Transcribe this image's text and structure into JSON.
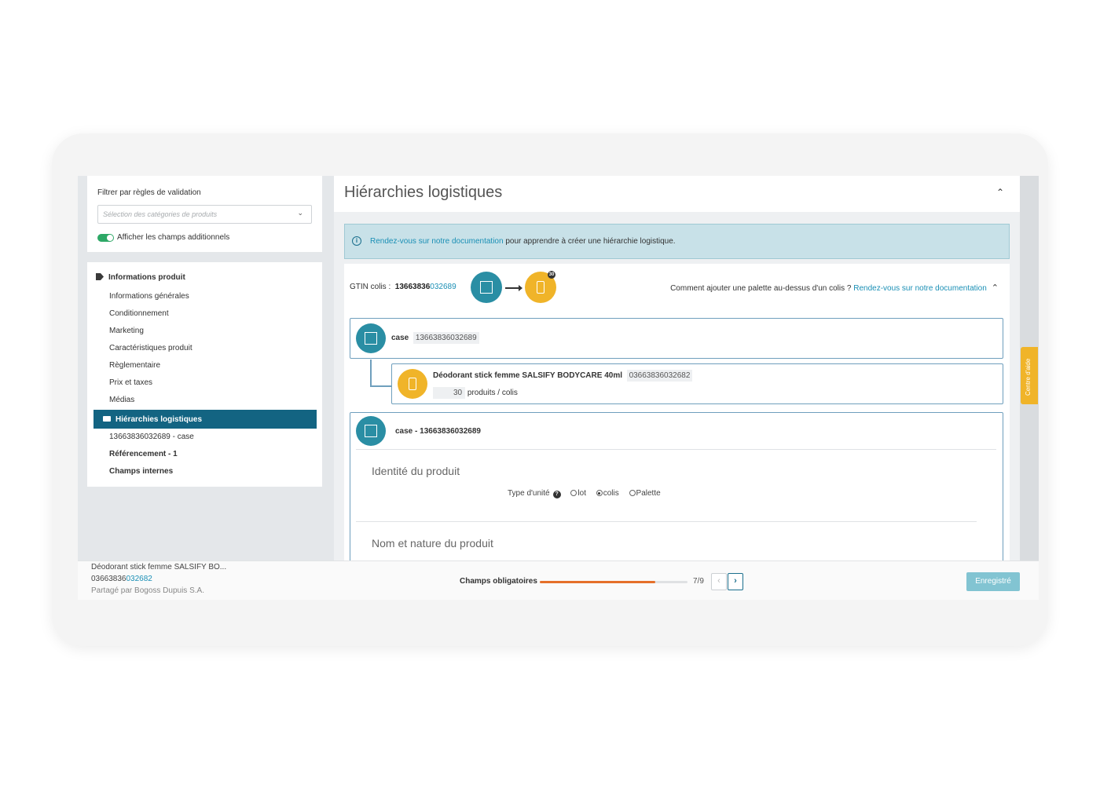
{
  "sidebar": {
    "filter_title": "Filtrer par règles de validation",
    "filter_placeholder": "Sélection des catégories de produits",
    "toggle_label": "Afficher les champs additionnels",
    "nav_heading": "Informations produit",
    "nav_items": [
      "Informations générales",
      "Conditionnement",
      "Marketing",
      "Caractéristiques produit",
      "Règlementaire",
      "Prix et taxes",
      "Médias"
    ],
    "active_item": "Hiérarchies logistiques",
    "sub_item": "13663836032689 - case",
    "referencing": "Référencement - 1",
    "internal_fields": "Champs internes"
  },
  "main": {
    "title": "Hiérarchies logistiques",
    "banner_link": "Rendez-vous sur notre documentation",
    "banner_text": " pour apprendre à créer une hiérarchie logistique.",
    "gtin_label": "GTIN colis :",
    "gtin_prefix": "13663836",
    "gtin_suffix": "032689",
    "badge_count": "30",
    "palette_question": "Comment ajouter une palette au-dessus d'un colis ? ",
    "palette_link": "Rendez-vous sur notre documentation",
    "case_label": "case",
    "case_gtin": "13663836032689",
    "product_name": "Déodorant stick femme SALSIFY BODYCARE 40ml",
    "product_gtin": "03663836032682",
    "qty_number": "30",
    "qty_unit": "produits / colis",
    "detail_title": "case - 13663836032689",
    "section_identity": "Identité du produit",
    "unit_type_label": "Type d'unité",
    "unit_options": [
      "lot",
      "colis",
      "Palette"
    ],
    "unit_selected": "colis",
    "section_name": "Nom et nature du produit"
  },
  "help_tab": "Centre d'aide",
  "footer": {
    "product_name": "Déodorant stick femme SALSIFY BO...",
    "gtin_prefix": "03663836",
    "gtin_suffix": "032682",
    "shared_by": "Partagé par Bogoss Dupuis S.A.",
    "required_label": "Champs obligatoires",
    "progress_fraction": 0.78,
    "count": "7/9",
    "save_label": "Enregistré"
  },
  "colors": {
    "accent": "#136482",
    "link": "#1a8fb5",
    "teal_icon": "#2a8ea4",
    "yellow_icon": "#f0b429",
    "progress": "#e5702a",
    "save": "#82c4d2"
  }
}
